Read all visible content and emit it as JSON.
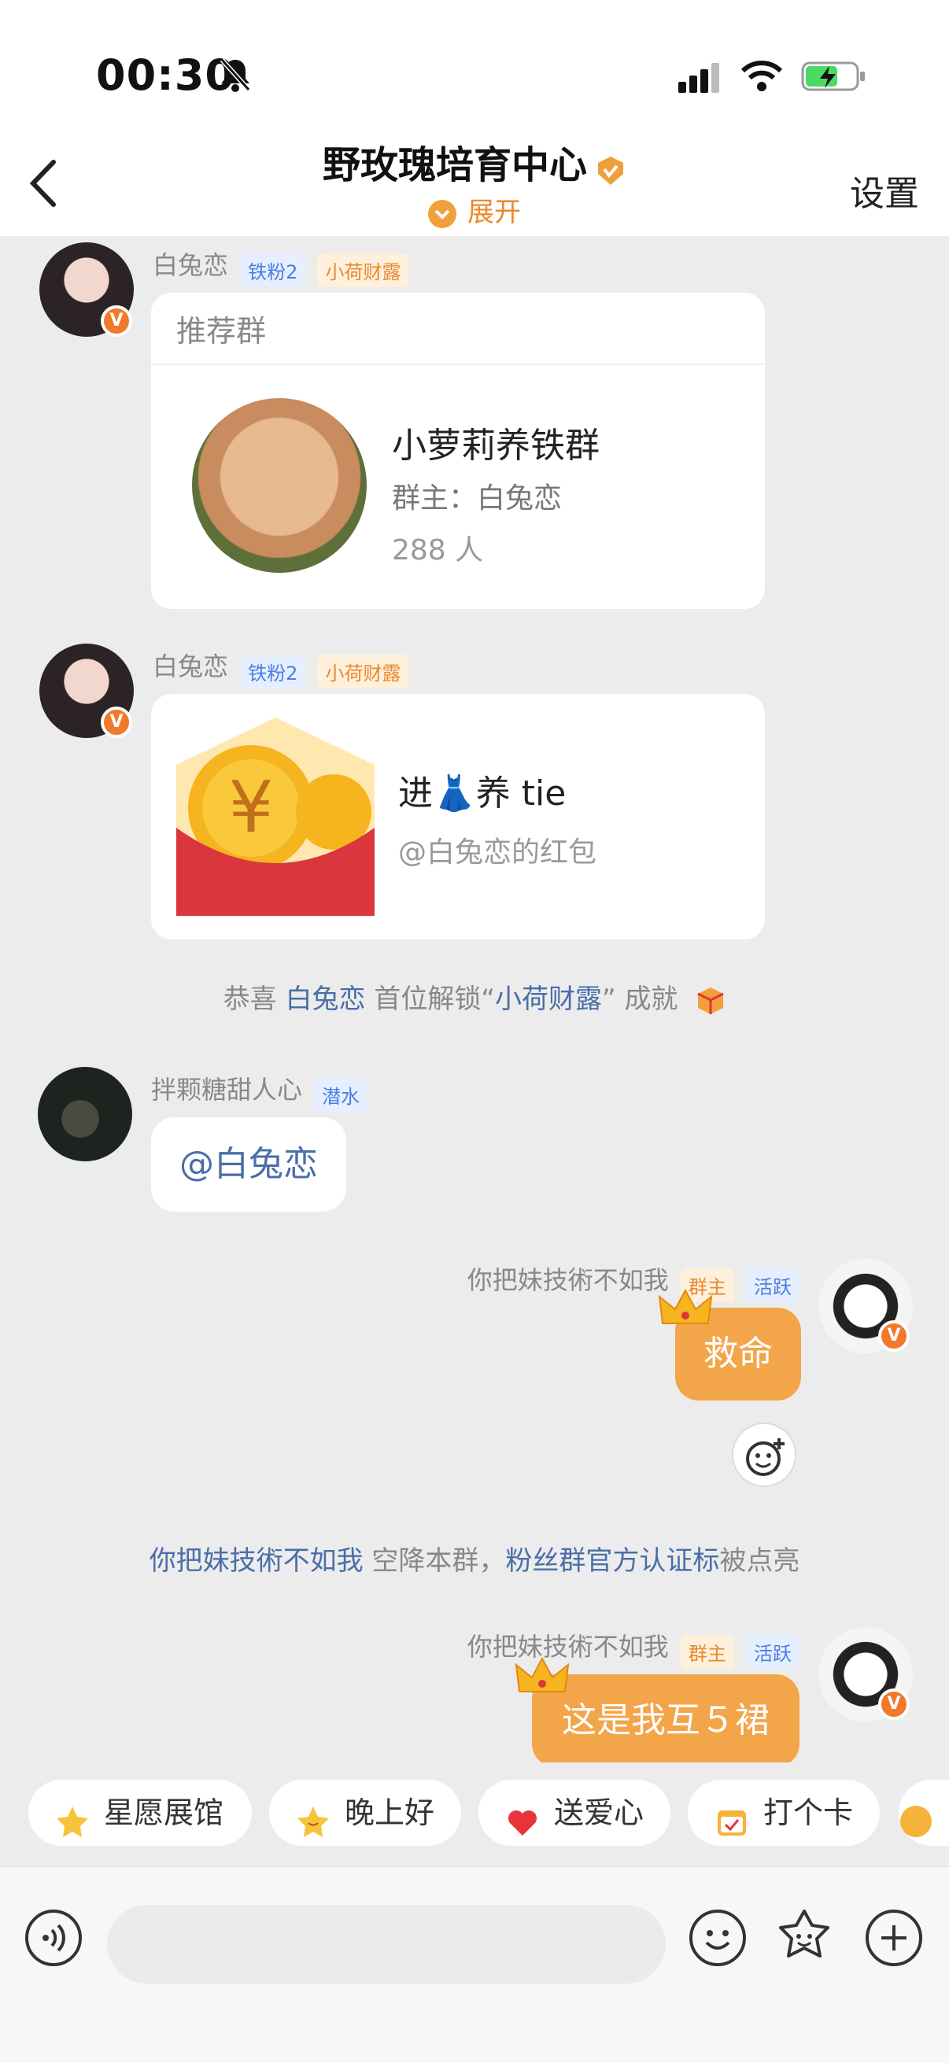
{
  "status_bar": {
    "time": "00:30"
  },
  "header": {
    "title": "野玫瑰培育中心",
    "subtitle": "展开",
    "settings": "设置"
  },
  "messages": {
    "m1": {
      "sender": "白兔恋",
      "tag1": "铁粉2",
      "tag2": "小荷财露",
      "card_header": "推荐群",
      "group_name": "小萝莉养铁群",
      "group_owner": "群主：白兔恋",
      "group_count": "288 人"
    },
    "m2": {
      "sender": "白兔恋",
      "tag1": "铁粉2",
      "tag2": "小荷财露",
      "redpacket_title": "进👗养 tie",
      "redpacket_sub": "@白兔恋的红包"
    },
    "sys1": {
      "prefix": "恭喜",
      "user": "白兔恋",
      "mid": "首位解锁",
      "quote_open": "“",
      "badge": "小荷财露",
      "quote_close": "”",
      "suffix": "成就"
    },
    "m3": {
      "sender": "拌颗糖甜人心",
      "tag": "潜水",
      "text": "@白兔恋"
    },
    "m4": {
      "sender": "你把妹技術不如我",
      "tag1": "群主",
      "tag2": "活跃",
      "text": "救命"
    },
    "sys2": {
      "user": "你把妹技術不如我",
      "mid": "空降本群，",
      "link": "粉丝群官方认证标",
      "suffix": "被点亮"
    },
    "m5": {
      "sender": "你把妹技術不如我",
      "tag1": "群主",
      "tag2": "活跃",
      "text": "这是我互５裙"
    }
  },
  "chips": [
    "星愿展馆",
    "晚上好",
    "送爱心",
    "打个卡"
  ],
  "colors": {
    "accent": "#e8892d",
    "link": "#4a6ea8",
    "bubble_self": "#f3a54a",
    "background": "#ececec"
  }
}
